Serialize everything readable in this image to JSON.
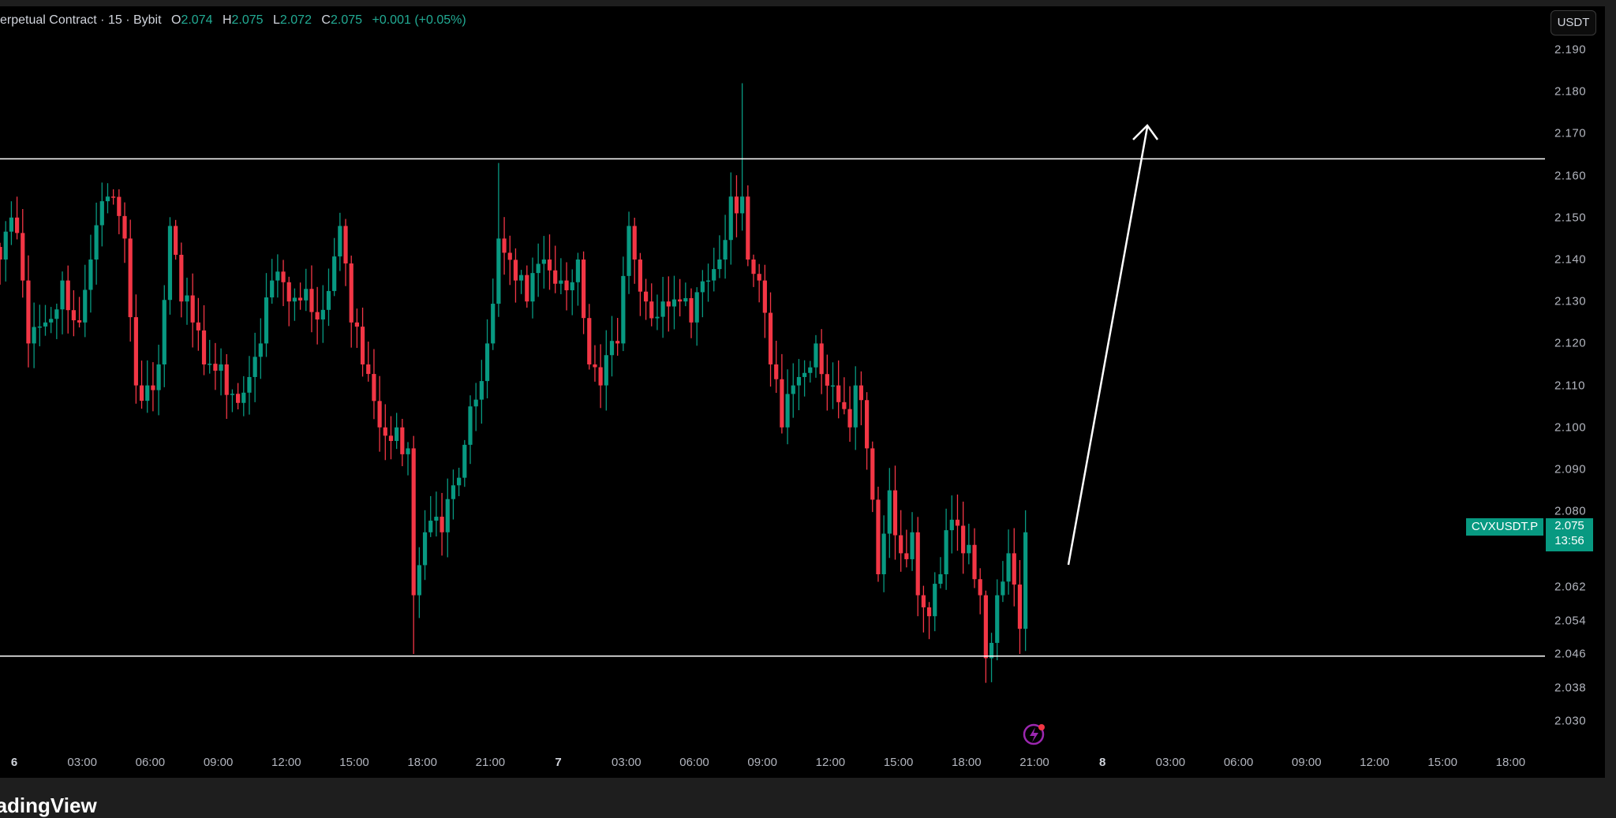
{
  "header": {
    "title": "erpetual Contract · 15 · Bybit",
    "open_label": "O",
    "open": "2.074",
    "high_label": "H",
    "high": "2.075",
    "low_label": "L",
    "low": "2.072",
    "close_label": "C",
    "close": "2.075",
    "change": "+0.001 (+0.05%)"
  },
  "currency_button": "USDT",
  "price_axis": [
    "2.190",
    "2.180",
    "2.170",
    "2.160",
    "2.150",
    "2.140",
    "2.130",
    "2.120",
    "2.110",
    "2.100",
    "2.090",
    "2.080",
    "2.062",
    "2.054",
    "2.046",
    "2.038",
    "2.030"
  ],
  "time_axis": [
    "6",
    "03:00",
    "06:00",
    "09:00",
    "12:00",
    "15:00",
    "18:00",
    "21:00",
    "7",
    "03:00",
    "06:00",
    "09:00",
    "12:00",
    "15:00",
    "18:00",
    "21:00",
    "8",
    "03:00",
    "06:00",
    "09:00",
    "12:00",
    "15:00",
    "18:00"
  ],
  "symbol_label": "CVXUSDT.P",
  "last_price": "2.075",
  "countdown": "13:56",
  "brand": "TradingView",
  "colors": {
    "up": "#089981",
    "down": "#f23645",
    "line": "#ffffff",
    "background": "#000000"
  },
  "chart_data": {
    "type": "candlestick",
    "interval_minutes": 15,
    "levels": {
      "resistance": 2.164,
      "support": 2.0455
    },
    "projection_arrow": {
      "from_price": 2.068,
      "to_price": 2.17
    },
    "key_closes": [
      [
        0,
        2.14
      ],
      [
        2,
        2.15
      ],
      [
        4,
        2.135
      ],
      [
        5,
        2.12
      ],
      [
        8,
        2.125
      ],
      [
        11,
        2.135
      ],
      [
        14,
        2.125
      ],
      [
        16,
        2.14
      ],
      [
        19,
        2.155
      ],
      [
        22,
        2.145
      ],
      [
        24,
        2.11
      ],
      [
        26,
        2.11
      ],
      [
        28,
        2.115
      ],
      [
        30,
        2.148
      ],
      [
        32,
        2.13
      ],
      [
        34,
        2.125
      ],
      [
        36,
        2.115
      ],
      [
        39,
        2.115
      ],
      [
        41,
        2.108
      ],
      [
        44,
        2.112
      ],
      [
        46,
        2.12
      ],
      [
        48,
        2.135
      ],
      [
        51,
        2.13
      ],
      [
        54,
        2.133
      ],
      [
        57,
        2.128
      ],
      [
        60,
        2.148
      ],
      [
        62,
        2.125
      ],
      [
        64,
        2.115
      ],
      [
        67,
        2.1
      ],
      [
        70,
        2.1
      ],
      [
        72,
        2.095
      ],
      [
        73,
        2.06
      ],
      [
        75,
        2.075
      ],
      [
        78,
        2.075
      ],
      [
        81,
        2.088
      ],
      [
        83,
        2.105
      ],
      [
        86,
        2.12
      ],
      [
        88,
        2.145
      ],
      [
        91,
        2.135
      ],
      [
        93,
        2.13
      ],
      [
        96,
        2.14
      ],
      [
        99,
        2.135
      ],
      [
        102,
        2.14
      ],
      [
        104,
        2.115
      ],
      [
        106,
        2.11
      ],
      [
        109,
        2.12
      ],
      [
        111,
        2.148
      ],
      [
        112,
        2.14
      ],
      [
        114,
        2.13
      ],
      [
        117,
        2.13
      ],
      [
        120,
        2.13
      ],
      [
        122,
        2.125
      ],
      [
        125,
        2.135
      ],
      [
        127,
        2.14
      ],
      [
        129,
        2.155
      ],
      [
        131,
        2.155
      ],
      [
        132,
        2.14
      ],
      [
        134,
        2.135
      ],
      [
        136,
        2.115
      ],
      [
        138,
        2.1
      ],
      [
        140,
        2.11
      ],
      [
        141,
        2.112
      ],
      [
        144,
        2.12
      ],
      [
        147,
        2.11
      ],
      [
        150,
        2.1
      ],
      [
        151,
        2.11
      ],
      [
        153,
        2.095
      ],
      [
        155,
        2.065
      ],
      [
        157,
        2.085
      ],
      [
        159,
        2.07
      ],
      [
        161,
        2.075
      ],
      [
        162,
        2.06
      ],
      [
        164,
        2.055
      ],
      [
        166,
        2.065
      ],
      [
        168,
        2.078
      ],
      [
        170,
        2.07
      ],
      [
        171,
        2.072
      ],
      [
        173,
        2.06
      ],
      [
        174,
        2.045
      ],
      [
        176,
        2.06
      ],
      [
        178,
        2.07
      ],
      [
        180,
        2.052
      ],
      [
        181,
        2.075
      ]
    ],
    "price_range": [
      2.022,
      2.196
    ]
  }
}
